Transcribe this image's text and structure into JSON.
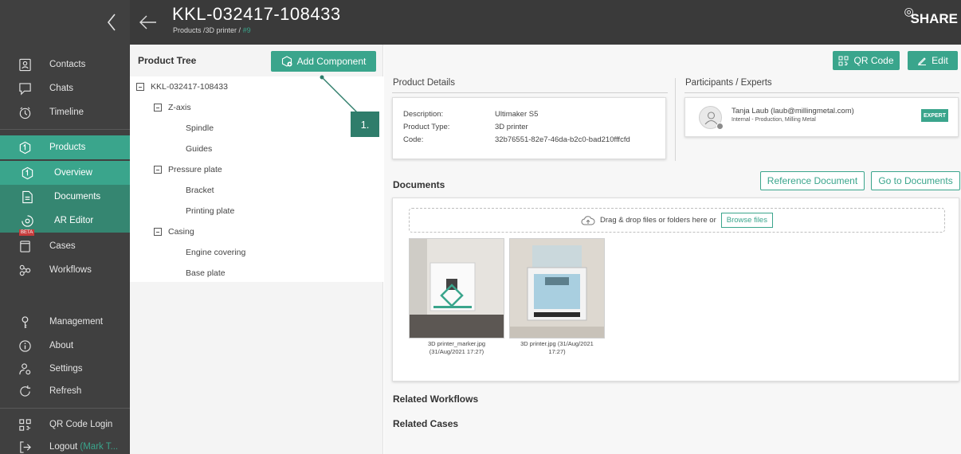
{
  "header": {
    "title": "KKL-032417-108433",
    "breadcrumb": "Products /3D printer /",
    "breadcrumb_hash": "#9",
    "logo": "SHARE"
  },
  "sidebar": {
    "items": [
      {
        "label": "Contacts",
        "icon": "contacts-icon"
      },
      {
        "label": "Chats",
        "icon": "chat-icon"
      },
      {
        "label": "Timeline",
        "icon": "timeline-icon"
      },
      {
        "label": "Products",
        "icon": "products-icon"
      },
      {
        "label": "Overview",
        "icon": "overview-icon"
      },
      {
        "label": "Documents",
        "icon": "documents-icon"
      },
      {
        "label": "AR Editor",
        "icon": "ar-editor-icon",
        "badge": "BETA"
      },
      {
        "label": "Cases",
        "icon": "cases-icon"
      },
      {
        "label": "Workflows",
        "icon": "workflows-icon"
      },
      {
        "label": "Management",
        "icon": "management-icon"
      },
      {
        "label": "About",
        "icon": "about-icon"
      },
      {
        "label": "Settings",
        "icon": "settings-icon"
      },
      {
        "label": "Refresh",
        "icon": "refresh-icon"
      },
      {
        "label": "QR Code Login",
        "icon": "qr-login-icon"
      },
      {
        "label": "Logout",
        "icon": "logout-icon",
        "user": "(Mark T..."
      }
    ]
  },
  "tree": {
    "title": "Product Tree",
    "add_label": "Add Component",
    "nodes": [
      {
        "label": "KKL-032417-108433",
        "level": 0,
        "toggle": true
      },
      {
        "label": "Z-axis",
        "level": 1,
        "toggle": true
      },
      {
        "label": "Spindle",
        "level": 2,
        "toggle": false
      },
      {
        "label": "Guides",
        "level": 2,
        "toggle": false
      },
      {
        "label": "Pressure plate",
        "level": 1,
        "toggle": true
      },
      {
        "label": "Bracket",
        "level": 2,
        "toggle": false
      },
      {
        "label": "Printing plate",
        "level": 2,
        "toggle": false
      },
      {
        "label": "Casing",
        "level": 1,
        "toggle": true
      },
      {
        "label": "Engine covering",
        "level": 2,
        "toggle": false
      },
      {
        "label": "Base plate",
        "level": 2,
        "toggle": false
      }
    ],
    "callout": "1."
  },
  "actions": {
    "qr_label": "QR Code",
    "edit_label": "Edit"
  },
  "details": {
    "title": "Product Details",
    "rows": [
      {
        "key": "Description:",
        "value": "Ultimaker S5"
      },
      {
        "key": "Product Type:",
        "value": "3D printer"
      },
      {
        "key": "Code:",
        "value": "32b76551-82e7-46da-b2c0-bad210fffcfd"
      }
    ]
  },
  "participants": {
    "title": "Participants / Experts",
    "name": "Tanja Laub (laub@millingmetal.com)",
    "org": "Internal - Production, Milling Metal",
    "badge": "EXPERT"
  },
  "documents": {
    "title": "Documents",
    "reference_label": "Reference Document",
    "goto_label": "Go to Documents",
    "dropzone_text": "Drag & drop files or folders here or",
    "browse_label": "Browse files",
    "files": [
      {
        "name": "3D printer_marker.jpg",
        "date": "(31/Aug/2021 17:27)"
      },
      {
        "name": "3D printer.jpg (31/Aug/2021",
        "date": "17:27)"
      }
    ]
  },
  "related": {
    "workflows": "Related Workflows",
    "cases": "Related Cases"
  },
  "colors": {
    "accent": "#3aa58c",
    "accent_dark": "#358671",
    "sidebar": "#404040",
    "topbar": "#3a3a3a"
  }
}
